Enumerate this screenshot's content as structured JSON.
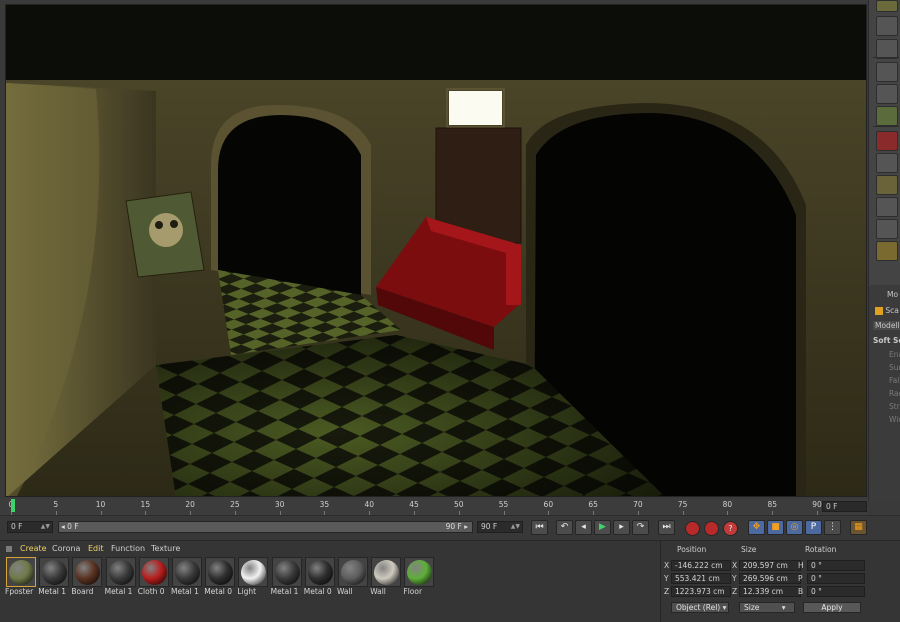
{
  "timeline": {
    "ticks": [
      "0",
      "5",
      "10",
      "15",
      "20",
      "25",
      "30",
      "35",
      "40",
      "45",
      "50",
      "55",
      "60",
      "65",
      "70",
      "75",
      "80",
      "85",
      "90"
    ],
    "current_frame_right": "0 F"
  },
  "transport": {
    "start_field": "0 F",
    "range_start": "0 F",
    "range_end": "90 F",
    "end_field": "90 F"
  },
  "material_manager": {
    "menu": [
      "Create",
      "Corona",
      "Edit",
      "Function",
      "Texture"
    ],
    "materials": [
      {
        "name": "Fposter",
        "color": "#6f7a48"
      },
      {
        "name": "Metal 1",
        "color": "#3a3a3a"
      },
      {
        "name": "Board",
        "color": "#5a3322"
      },
      {
        "name": "Metal 1",
        "color": "#3a3a3a"
      },
      {
        "name": "Cloth 0",
        "color": "#b81e1e"
      },
      {
        "name": "Metal 1",
        "color": "#3a3a3a"
      },
      {
        "name": "Metal 0",
        "color": "#2f2f2f"
      },
      {
        "name": "Light",
        "color": "#f2f2f2"
      },
      {
        "name": "Metal 1",
        "color": "#3a3a3a"
      },
      {
        "name": "Metal 0",
        "color": "#2f2f2f"
      },
      {
        "name": "Wall",
        "color": "#5e5e5e"
      },
      {
        "name": "Wall",
        "color": "#cfcabf"
      },
      {
        "name": "Floor",
        "color": "#5fae3a"
      }
    ]
  },
  "coordinates": {
    "headers": {
      "position": "Position",
      "size": "Size",
      "rotation": "Rotation"
    },
    "rows": [
      {
        "axis": "X",
        "pos": "-146.222 cm",
        "size_axis": "X",
        "size": "209.597 cm",
        "rot_axis": "H",
        "rot": "0 °"
      },
      {
        "axis": "Y",
        "pos": "553.421 cm",
        "size_axis": "Y",
        "size": "269.596 cm",
        "rot_axis": "P",
        "rot": "0 °"
      },
      {
        "axis": "Z",
        "pos": "1223.973 cm",
        "size_axis": "Z",
        "size": "12.339 cm",
        "rot_axis": "B",
        "rot": "0 °"
      }
    ],
    "mode_dropdown": "Object (Rel)",
    "size_dropdown": "Size",
    "apply_label": "Apply"
  },
  "attributes": {
    "tab_label": "Mo",
    "object_label": "Sca",
    "modelling_tab": "Modelli",
    "soft_selection": "Soft Sel",
    "items": [
      "Ena",
      "Surf",
      "Fall",
      "Rad",
      "Stre",
      "Wid"
    ]
  }
}
